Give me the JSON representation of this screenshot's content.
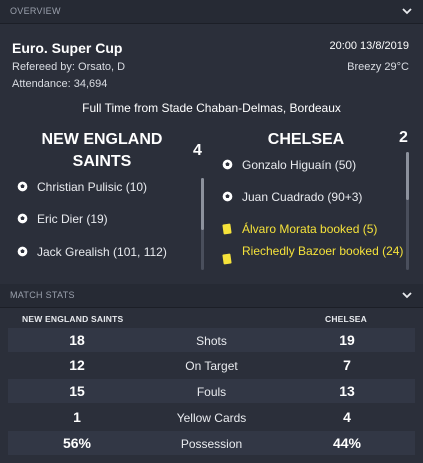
{
  "overview": {
    "section_title": "OVERVIEW",
    "competition": "Euro. Super Cup",
    "referee": "Refereed by: Orsato, D",
    "attendance": "Attendance: 34,694",
    "datetime": "20:00 13/8/2019",
    "weather": "Breezy 29°C",
    "venue": "Full Time from Stade Chaban-Delmas, Bordeaux",
    "home": {
      "name": "NEW ENGLAND SAINTS",
      "score": "4",
      "events": [
        {
          "icon": "goal-ball-icon",
          "text": "Christian Pulisic (10)"
        },
        {
          "icon": "goal-ball-icon",
          "text": "Eric Dier (19)"
        },
        {
          "icon": "goal-ball-icon",
          "text": "Jack Grealish (101, 112)"
        }
      ]
    },
    "away": {
      "name": "CHELSEA",
      "score": "2",
      "events": [
        {
          "icon": "goal-ball-icon",
          "text": "Gonzalo Higuaín (50)"
        },
        {
          "icon": "goal-ball-icon",
          "text": "Juan Cuadrado (90+3)"
        },
        {
          "icon": "yellow-card-icon",
          "text": "Álvaro Morata booked (5)"
        },
        {
          "icon": "yellow-card-icon",
          "text": "Riechedly Bazoer booked (24)"
        }
      ]
    }
  },
  "match_stats": {
    "section_title": "MATCH STATS",
    "home_team": "NEW ENGLAND SAINTS",
    "away_team": "CHELSEA",
    "rows": [
      {
        "label": "Shots",
        "home": "18",
        "away": "19"
      },
      {
        "label": "On Target",
        "home": "12",
        "away": "7"
      },
      {
        "label": "Fouls",
        "home": "15",
        "away": "13"
      },
      {
        "label": "Yellow Cards",
        "home": "1",
        "away": "4"
      },
      {
        "label": "Possession",
        "home": "56%",
        "away": "44%"
      }
    ]
  },
  "colors": {
    "background": "#2b2f3a",
    "header": "#262a34",
    "booking_text": "#f5e23a",
    "stripe": "#323745"
  }
}
